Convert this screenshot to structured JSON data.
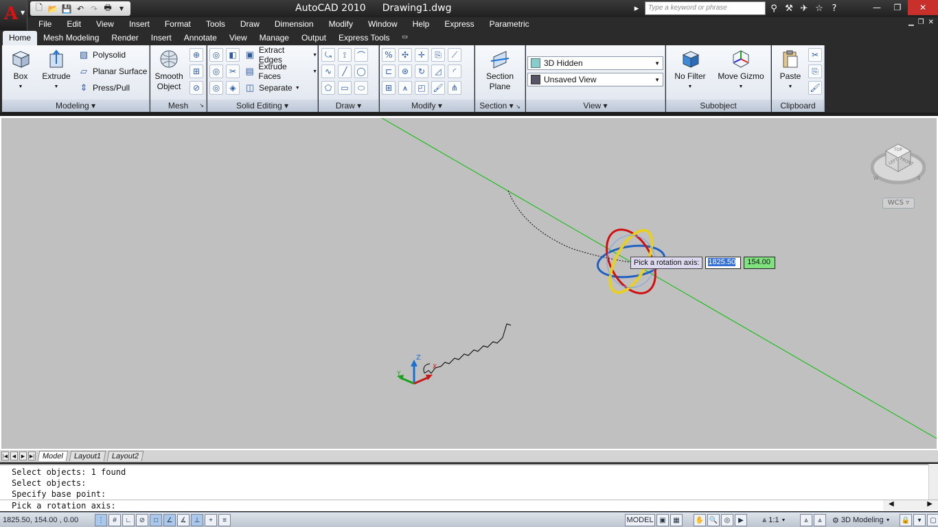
{
  "app": {
    "title": "AutoCAD 2010",
    "document": "Drawing1.dwg",
    "search_placeholder": "Type a keyword or phrase"
  },
  "qat_icons": [
    "new-icon",
    "open-icon",
    "save-icon",
    "undo-icon",
    "redo-icon",
    "plot-icon"
  ],
  "menus": [
    "File",
    "Edit",
    "View",
    "Insert",
    "Format",
    "Tools",
    "Draw",
    "Dimension",
    "Modify",
    "Window",
    "Help",
    "Express",
    "Parametric"
  ],
  "ribbon_tabs": [
    "Home",
    "Mesh Modeling",
    "Render",
    "Insert",
    "Annotate",
    "View",
    "Manage",
    "Output",
    "Express Tools"
  ],
  "ribbon": {
    "modeling": {
      "title": "Modeling",
      "box": "Box",
      "extrude": "Extrude",
      "polysolid": "Polysolid",
      "planar_surface": "Planar Surface",
      "press_pull": "Press/Pull"
    },
    "mesh": {
      "title": "Mesh",
      "smooth_object_1": "Smooth",
      "smooth_object_2": "Object"
    },
    "solid_editing": {
      "title": "Solid Editing",
      "extract_edges": "Extract Edges",
      "extrude_faces": "Extrude Faces",
      "separate": "Separate"
    },
    "draw": {
      "title": "Draw"
    },
    "modify": {
      "title": "Modify"
    },
    "section": {
      "title": "Section",
      "section_plane_1": "Section",
      "section_plane_2": "Plane"
    },
    "view": {
      "title": "View",
      "visual_style": "3D Hidden",
      "named_view": "Unsaved View"
    },
    "subobject": {
      "title": "Subobject",
      "no_filter": "No Filter",
      "move_gizmo": "Move Gizmo"
    },
    "clipboard": {
      "title": "Clipboard",
      "paste": "Paste"
    }
  },
  "viewport": {
    "viewcube": {
      "top": "TOP",
      "left": "LEFT",
      "front": "FRONT",
      "w": "W",
      "s": "S"
    },
    "wcs": "WCS",
    "ucs": {
      "x": "X",
      "y": "Y",
      "z": "Z"
    },
    "tooltip": {
      "message": "Pick a rotation axis:",
      "x_value": "1825.50",
      "y_value": "154.00"
    },
    "colors": {
      "axis_line": "#00c000",
      "gizmo_red": "#d01010",
      "gizmo_yellow": "#e8d020",
      "gizmo_blue": "#2060c0"
    }
  },
  "layout_tabs": [
    "Model",
    "Layout1",
    "Layout2"
  ],
  "command_history": [
    "Select objects: 1 found",
    "Select objects:",
    "Specify base point:"
  ],
  "command_prompt": "Pick a rotation axis:",
  "status": {
    "coords": "1825.50, 154.00 , 0.00",
    "model": "MODEL",
    "scale": "1:1",
    "workspace": "3D Modeling"
  }
}
